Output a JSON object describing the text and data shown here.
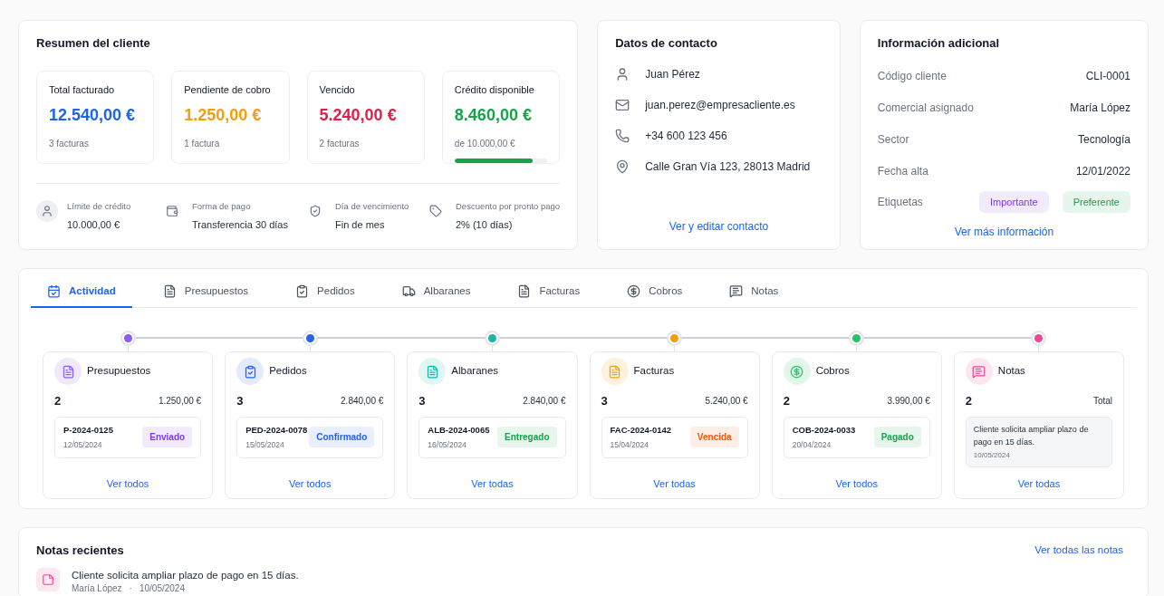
{
  "summary": {
    "title": "Resumen del cliente",
    "metrics": [
      {
        "label": "Total facturado",
        "value": "12.540,00 €",
        "color": "#1d63ed",
        "note": "3 facturas"
      },
      {
        "label": "Pendiente de cobro",
        "value": "1.250,00 €",
        "color": "#f59e0b",
        "note": "1 factura"
      },
      {
        "label": "Vencido",
        "value": "5.240,00 €",
        "color": "#e11d48",
        "note": "2 facturas"
      },
      {
        "label": "Crédito disponible",
        "value": "8.460,00 €",
        "color": "#16a34a",
        "note": "de 10.000,00 €",
        "level": 0.846
      }
    ],
    "details": [
      {
        "kind": "user",
        "label": "Límite de crédito",
        "value": "10.000,00 €"
      },
      {
        "kind": "wallet",
        "label": "Forma de pago",
        "value": "Transferencia 30 días"
      },
      {
        "kind": "shield",
        "label": "Día de vencimiento",
        "value": "Fin de mes"
      },
      {
        "kind": "tag",
        "label": "Descuento por pronto pago",
        "value": "2% (10 días)"
      }
    ]
  },
  "contact": {
    "title": "Datos de contacto",
    "items": [
      {
        "kind": "user",
        "text": "Juan Pérez"
      },
      {
        "kind": "mail",
        "text": "juan.perez@empresacliente.es"
      },
      {
        "kind": "phone",
        "text": "+34 600 123 456"
      },
      {
        "kind": "pin",
        "text": "Calle Gran Vía 123, 28013 Madrid"
      }
    ],
    "link": "Ver y editar contacto"
  },
  "info": {
    "title": "Información adicional",
    "rows": [
      {
        "label": "Código cliente",
        "value": "CLI-0001"
      },
      {
        "label": "Comercial asignado",
        "value": "María López"
      },
      {
        "label": "Sector",
        "value": "Tecnología"
      },
      {
        "label": "Fecha alta",
        "value": "12/01/2022"
      }
    ],
    "tags_label": "Etiquetas",
    "tags": [
      {
        "text": "Importante",
        "color": "#7c3aed"
      },
      {
        "text": "Preferente",
        "color": "#16a34a"
      }
    ],
    "link": "Ver más información"
  },
  "tabs": [
    {
      "kind": "activity",
      "label": "Actividad",
      "selected": true
    },
    {
      "kind": "doc",
      "label": "Presupuestos",
      "selected": false
    },
    {
      "kind": "order",
      "label": "Pedidos",
      "selected": false
    },
    {
      "kind": "truck",
      "label": "Albaranes",
      "selected": false
    },
    {
      "kind": "doc",
      "label": "Facturas",
      "selected": false
    },
    {
      "kind": "money",
      "label": "Cobros",
      "selected": false
    },
    {
      "kind": "note",
      "label": "Notas",
      "selected": false
    }
  ],
  "stages": [
    {
      "kind": "record",
      "color": "#8b5cf6",
      "title": "Presupuestos",
      "count": "2",
      "amount": "1.250,00 €",
      "code": "P-2024-0125",
      "date": "12/05/2024",
      "status": {
        "text": "Enviado",
        "color": "#7c3aed"
      },
      "link": "Ver todos"
    },
    {
      "kind": "record",
      "color": "#2563eb",
      "title": "Pedidos",
      "count": "3",
      "amount": "2.840,00 €",
      "code": "PED-2024-0078",
      "date": "15/05/2024",
      "status": {
        "text": "Confirmado",
        "color": "#2563eb"
      },
      "link": "Ver todos"
    },
    {
      "kind": "record",
      "color": "#14b8a6",
      "title": "Albaranes",
      "count": "3",
      "amount": "2.840,00 €",
      "code": "ALB-2024-0065",
      "date": "16/05/2024",
      "status": {
        "text": "Entregado",
        "color": "#16a34a"
      },
      "link": "Ver todas"
    },
    {
      "kind": "record",
      "color": "#f59e0b",
      "title": "Facturas",
      "count": "3",
      "amount": "5.240,00 €",
      "code": "FAC-2024-0142",
      "date": "15/04/2024",
      "status": {
        "text": "Vencida",
        "color": "#ea580c"
      },
      "link": "Ver todas"
    },
    {
      "kind": "record",
      "color": "#22c55e",
      "title": "Cobros",
      "count": "2",
      "amount": "3.990,00 €",
      "code": "COB-2024-0033",
      "date": "20/04/2024",
      "status": {
        "text": "Pagado",
        "color": "#16a34a"
      },
      "link": "Ver todos"
    },
    {
      "kind": "note",
      "color": "#ec4899",
      "title": "Notas",
      "count": "2",
      "amount": "Total",
      "text": "Cliente solicita ampliar plazo de pago en 15 días.",
      "date": "10/05/2024",
      "link": "Ver todas"
    }
  ],
  "recent_notes": {
    "title": "Notas recientes",
    "link": "Ver todas las notas",
    "items": [
      {
        "text": "Cliente solicita ampliar plazo de pago en 15 días.",
        "author": "María López",
        "separator": "·",
        "date": "10/05/2024"
      }
    ]
  }
}
